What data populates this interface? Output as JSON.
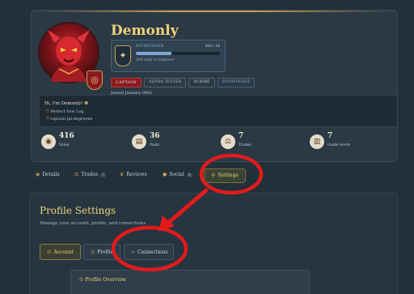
{
  "profile": {
    "username": "Demonly",
    "xp": {
      "rank": "PATHFINDER",
      "count": "418 / 1k",
      "note": "584 until to Explorer",
      "progress": 0.42
    },
    "badges": [
      "CAPTAIN",
      "ALPHA TESTER",
      "SCRIBE",
      "PATHFINDER"
    ],
    "joined": "Joined January 0001",
    "bio": {
      "greeting": "Hi, I'm Demonly!",
      "link1": "Perfect Vow Log",
      "link2": "captain-jal-degreene"
    },
    "stats": [
      {
        "value": "416",
        "label": "Value",
        "icon": "coin-icon"
      },
      {
        "value": "36",
        "label": "Posts",
        "icon": "scroll-icon"
      },
      {
        "value": "7",
        "label": "Trades",
        "icon": "scales-icon"
      },
      {
        "value": "7",
        "label": "Guide Score",
        "icon": "book-icon"
      }
    ]
  },
  "tabs": {
    "details": "Details",
    "trades": "Trades",
    "trades_count": "7",
    "reviews": "Reviews",
    "social": "Social",
    "social_count": "3",
    "settings": "Settings"
  },
  "settings": {
    "title": "Profile Settings",
    "subtitle": "Manage your account, profile, and connections",
    "tabs": {
      "account": "Account",
      "profile": "Profile",
      "connections": "Connections"
    },
    "overview_title": "Profile Overview"
  },
  "colors": {
    "accent": "#f0d27a",
    "annotation": "#e11b1b",
    "background": "#22303a"
  }
}
